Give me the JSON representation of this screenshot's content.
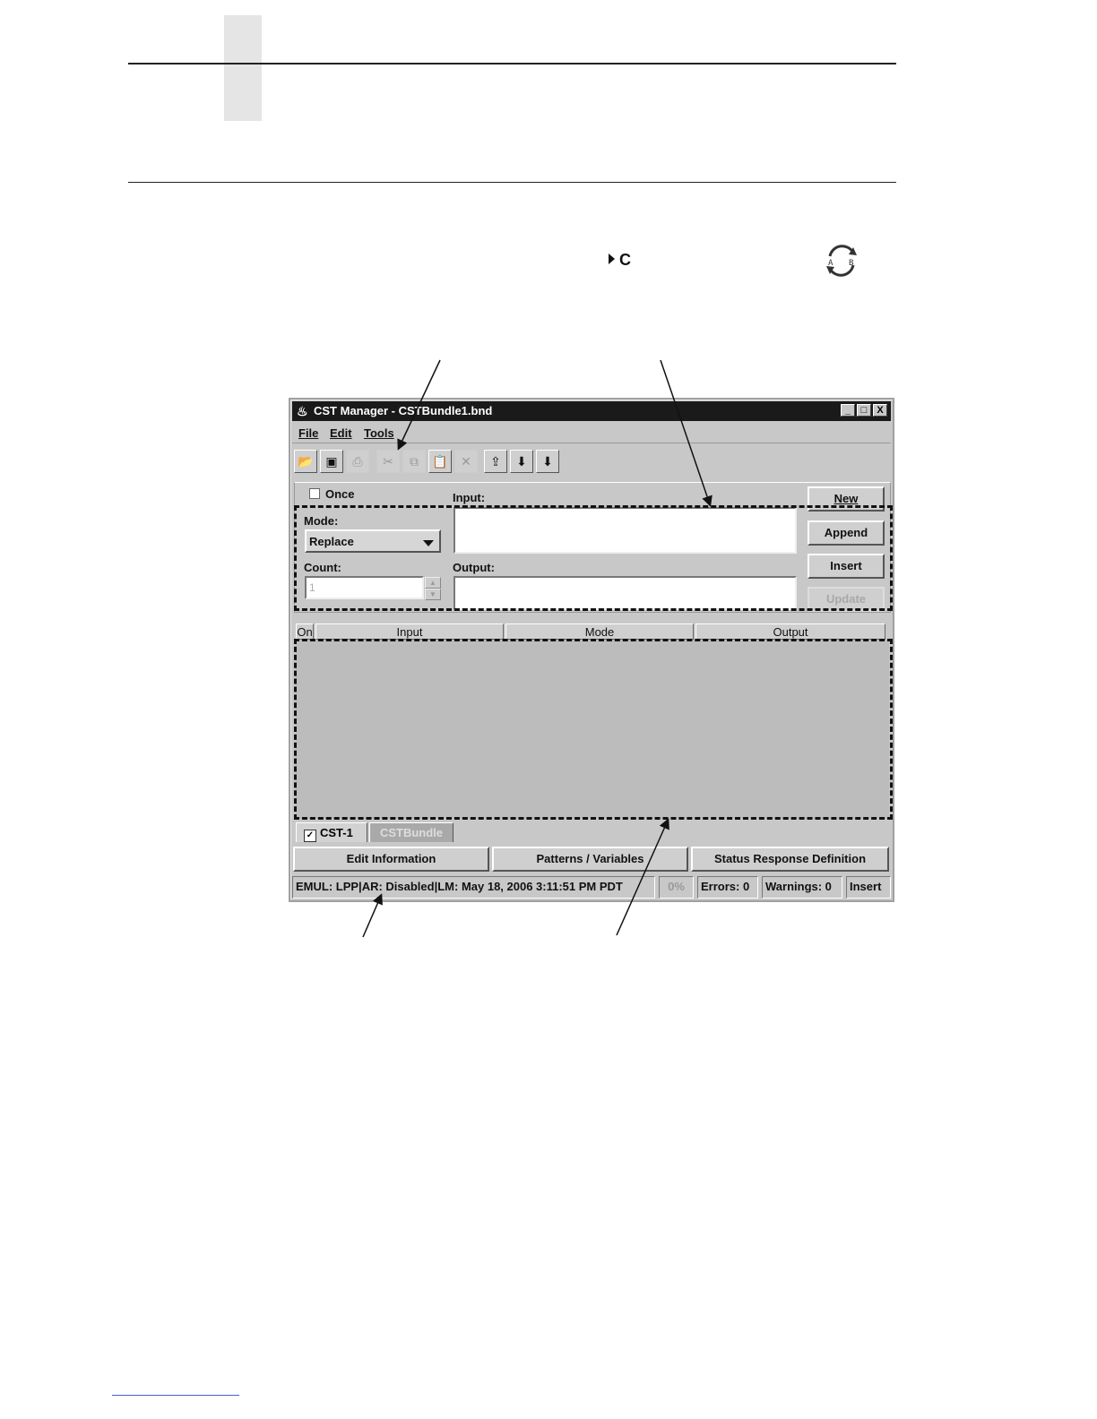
{
  "page": {
    "step_marker": "C"
  },
  "window": {
    "title": "CST Manager - CSTBundle1.bnd",
    "controls": {
      "minimize": "_",
      "maximize": "□",
      "close": "X"
    },
    "menu": [
      "File",
      "Edit",
      "Tools"
    ],
    "toolbar_icons": [
      "open-icon",
      "save-icon",
      "print-icon",
      "cut-icon",
      "copy-icon",
      "paste-icon",
      "delete-icon",
      "upload-icon",
      "download-u-icon",
      "download-d-icon"
    ],
    "form": {
      "once_label": "Once",
      "mode_label": "Mode:",
      "mode_value": "Replace",
      "count_label": "Count:",
      "count_value": "1",
      "input_label": "Input:",
      "output_label": "Output:",
      "input_value": "",
      "output_value": ""
    },
    "buttons": {
      "new": "New",
      "append": "Append",
      "insert": "Insert",
      "update": "Update"
    },
    "table": {
      "columns": [
        "On",
        "Input",
        "Mode",
        "Output"
      ],
      "rows": []
    },
    "tabs": [
      {
        "label": "CST-1",
        "checked": true
      },
      {
        "label": "CSTBundle",
        "checked": false
      }
    ],
    "bottom_buttons": [
      "Edit Information",
      "Patterns / Variables",
      "Status Response Definition"
    ],
    "status_bar": {
      "info": "EMUL: LPP|AR: Disabled|LM: May 18, 2006 3:11:51 PM PDT",
      "progress": "0%",
      "errors": "Errors: 0",
      "warnings": "Warnings: 0",
      "mode": "Insert"
    }
  }
}
